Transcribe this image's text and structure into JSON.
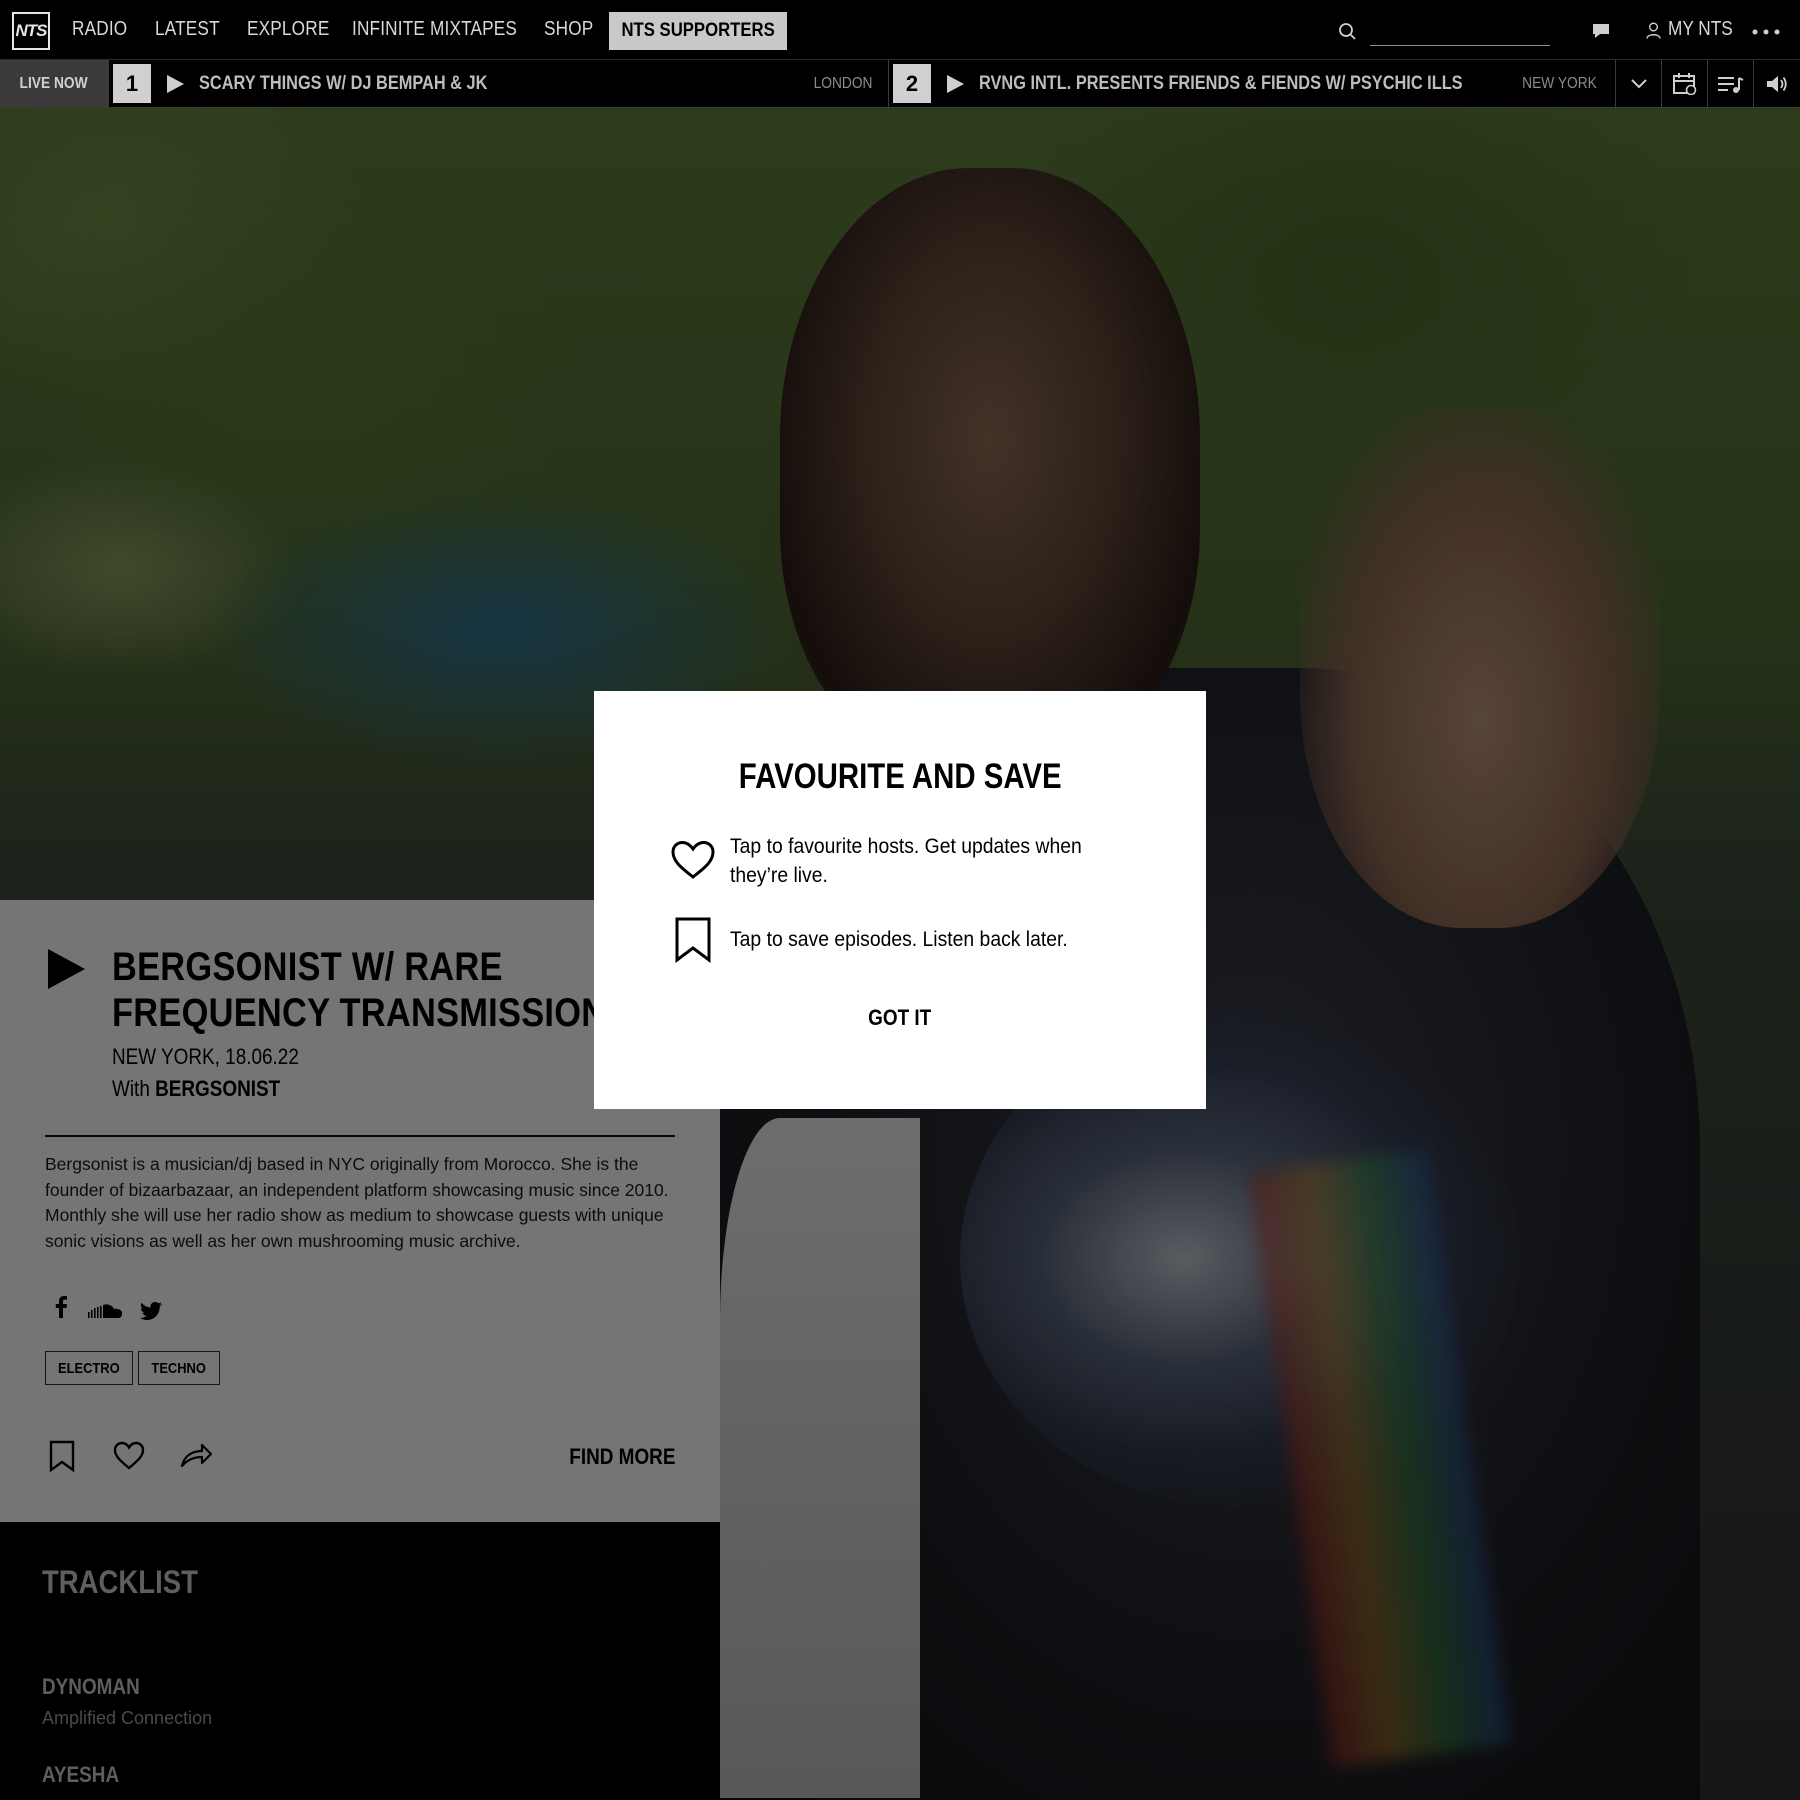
{
  "logo": {
    "text": "NTS"
  },
  "nav": {
    "items": [
      "RADIO",
      "LATEST",
      "EXPLORE",
      "INFINITE MIXTAPES",
      "SHOP"
    ],
    "supporters": "NTS SUPPORTERS",
    "search_value": "",
    "my_nts": "MY NTS"
  },
  "live": {
    "label": "LIVE NOW",
    "channels": [
      {
        "number": "1",
        "title": "SCARY THINGS W/ DJ BEMPAH & JK",
        "location": "LONDON"
      },
      {
        "number": "2",
        "title": "RVNG INTL. PRESENTS FRIENDS & FIENDS W/ PSYCHIC ILLS",
        "location": "NEW YORK"
      }
    ]
  },
  "episode": {
    "title_line1": "BERGSONIST W/ RARE",
    "title_line2": "FREQUENCY TRANSMISSION",
    "location_date": "NEW YORK, 18.06.22",
    "with_prefix": "With",
    "host": "BERGSONIST",
    "description": "Bergsonist is a musician/dj based in NYC originally from Morocco. She is the founder of bizaarbazaar, an independent platform showcasing music since 2010. Monthly she will use her radio show as medium to showcase guests with unique sonic visions as well as her own mushrooming music archive.",
    "genres": [
      "ELECTRO",
      "TECHNO"
    ],
    "find_more": "FIND MORE"
  },
  "tracklist": {
    "title": "TRACKLIST",
    "tracks": [
      {
        "artist": "DYNOMAN",
        "title": "Amplified Connection"
      },
      {
        "artist": "AYESHA",
        "title": ""
      }
    ]
  },
  "modal": {
    "title": "FAVOURITE AND SAVE",
    "favourite_text": "Tap to favourite hosts. Get updates when they’re live.",
    "save_text": "Tap to save episodes. Listen back later.",
    "button": "GOT IT"
  }
}
